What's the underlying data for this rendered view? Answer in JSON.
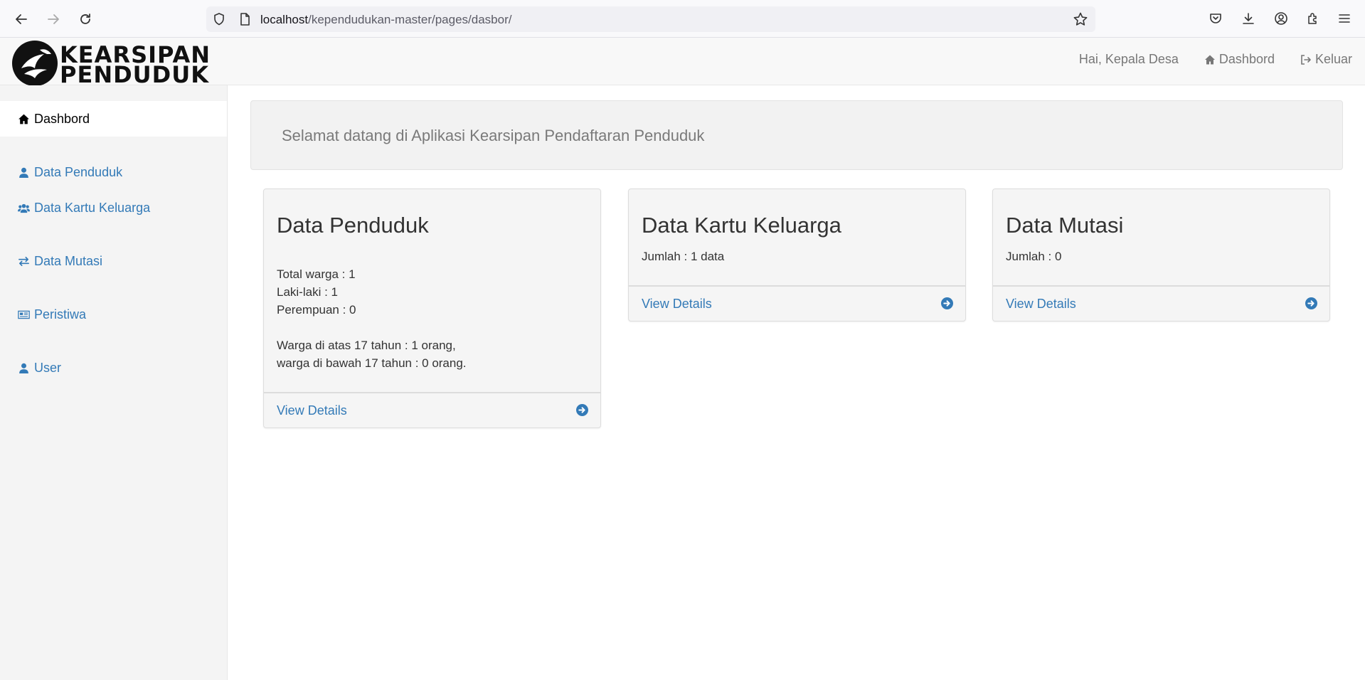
{
  "browser": {
    "url_host": "localhost",
    "url_path": "/kependudukan-master/pages/dasbor/"
  },
  "header": {
    "logo_line1": "KEARSIPAN",
    "logo_line2": "PENDUDUK",
    "greeting": "Hai, Kepala Desa",
    "dashboard_label": "Dashbord",
    "logout_label": "Keluar"
  },
  "sidebar": {
    "items": [
      {
        "label": "Dashbord",
        "icon": "home-icon"
      },
      {
        "label": "Data Penduduk",
        "icon": "user-icon"
      },
      {
        "label": "Data Kartu Keluarga",
        "icon": "users-icon"
      },
      {
        "label": "Data Mutasi",
        "icon": "exchange-icon"
      },
      {
        "label": "Peristiwa",
        "icon": "newspaper-icon"
      },
      {
        "label": "User",
        "icon": "user-icon"
      }
    ]
  },
  "main": {
    "welcome": "Selamat datang di Aplikasi Kearsipan Pendaftaran Penduduk",
    "panels": [
      {
        "title": "Data Penduduk",
        "lines": [
          "Total warga : 1",
          "Laki-laki : 1",
          "Perempuan : 0",
          "Warga di atas 17 tahun : 1 orang,",
          "warga di bawah 17 tahun : 0 orang."
        ],
        "link": "View Details"
      },
      {
        "title": "Data Kartu Keluarga",
        "lines": [
          "Jumlah : 1 data"
        ],
        "link": "View Details"
      },
      {
        "title": "Data Mutasi",
        "lines": [
          "Jumlah : 0"
        ],
        "link": "View Details"
      }
    ]
  },
  "colors": {
    "link": "#337ab7",
    "panel_bg": "#f5f5f5",
    "sidebar_bg": "#f4f4f4"
  }
}
